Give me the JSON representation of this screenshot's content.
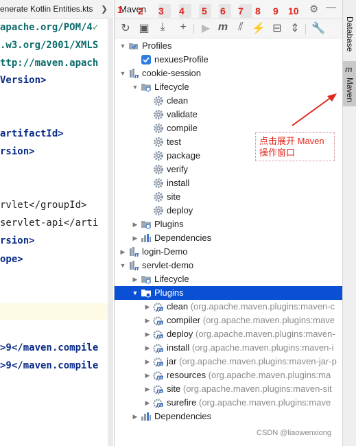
{
  "editor": {
    "tab_title": "enerate Kotlin Entities.kts",
    "tab_chevron": "❯",
    "code_lines": [
      {
        "text": "apache.org/POM/4",
        "extra": "✓"
      },
      {
        "text": ".w3.org/2001/XMLS",
        "extra": ""
      },
      {
        "text": "ttp://maven.apach",
        "extra": ""
      },
      {
        "text": "Version>",
        "extra": ""
      },
      {
        "text": "artifactId>",
        "extra": ""
      },
      {
        "text": "rsion>",
        "extra": ""
      },
      {
        "text": "rvlet</groupId>",
        "extra": ""
      },
      {
        "text": "servlet-api</arti",
        "extra": ""
      },
      {
        "text": "rsion>",
        "extra": ""
      },
      {
        "text": "ope>",
        "extra": ""
      },
      {
        "text": ">9</maven.compile",
        "extra": ""
      },
      {
        "text": ">9</maven.compile",
        "extra": ""
      }
    ]
  },
  "panel": {
    "title": "Maven",
    "numbers": [
      "1",
      "2",
      "3",
      "4",
      "5",
      "6",
      "7",
      "8",
      "9",
      "10"
    ]
  },
  "tree": [
    {
      "label": "Profiles",
      "detail": "",
      "icon": "profiles-icon"
    },
    {
      "label": "nexuesProfile",
      "detail": "",
      "icon": "checkbox-checked-icon"
    },
    {
      "label": "cookie-session",
      "detail": "",
      "icon": "maven-module-icon"
    },
    {
      "label": "Lifecycle",
      "detail": "",
      "icon": "lifecycle-folder-icon"
    },
    {
      "label": "clean",
      "detail": "",
      "icon": "gear-icon"
    },
    {
      "label": "validate",
      "detail": "",
      "icon": "gear-icon"
    },
    {
      "label": "compile",
      "detail": "",
      "icon": "gear-icon"
    },
    {
      "label": "test",
      "detail": "",
      "icon": "gear-icon"
    },
    {
      "label": "package",
      "detail": "",
      "icon": "gear-icon"
    },
    {
      "label": "verify",
      "detail": "",
      "icon": "gear-icon"
    },
    {
      "label": "install",
      "detail": "",
      "icon": "gear-icon"
    },
    {
      "label": "site",
      "detail": "",
      "icon": "gear-icon"
    },
    {
      "label": "deploy",
      "detail": "",
      "icon": "gear-icon"
    },
    {
      "label": "Plugins",
      "detail": "",
      "icon": "plugins-folder-icon"
    },
    {
      "label": "Dependencies",
      "detail": "",
      "icon": "dependencies-icon"
    },
    {
      "label": "login-Demo",
      "detail": "",
      "icon": "maven-module-icon"
    },
    {
      "label": "servlet-demo",
      "detail": "",
      "icon": "maven-module-icon"
    },
    {
      "label": "Lifecycle",
      "detail": "",
      "icon": "lifecycle-folder-icon"
    },
    {
      "label": "Plugins",
      "detail": "",
      "icon": "plugins-folder-icon"
    },
    {
      "label": "clean",
      "detail": "(org.apache.maven.plugins:maven-c",
      "icon": "plugin-goal-icon"
    },
    {
      "label": "compiler",
      "detail": "(org.apache.maven.plugins:mave",
      "icon": "plugin-goal-icon"
    },
    {
      "label": "deploy",
      "detail": "(org.apache.maven.plugins:maven-",
      "icon": "plugin-goal-icon"
    },
    {
      "label": "install",
      "detail": "(org.apache.maven.plugins:maven-i",
      "icon": "plugin-goal-icon"
    },
    {
      "label": "jar",
      "detail": "(org.apache.maven.plugins:maven-jar-p",
      "icon": "plugin-goal-icon"
    },
    {
      "label": "resources",
      "detail": "(org.apache.maven.plugins:ma",
      "icon": "plugin-goal-icon"
    },
    {
      "label": "site",
      "detail": "(org.apache.maven.plugins:maven-sit",
      "icon": "plugin-goal-icon"
    },
    {
      "label": "surefire",
      "detail": "(org.apache.maven.plugins:mave",
      "icon": "plugin-goal-icon"
    },
    {
      "label": "Dependencies",
      "detail": "",
      "icon": "dependencies-icon"
    }
  ],
  "sidebar": {
    "database_label": "Database",
    "maven_label": "Maven"
  },
  "annotation": {
    "line1": "点击展开 Maven",
    "line2": "操作窗口"
  },
  "watermark": "CSDN @liaowenxiong",
  "colors": {
    "selection": "#0a50d4",
    "annotation_red": "#e0251b",
    "code_teal": "#0b6b6b",
    "code_navy": "#0a2b87"
  }
}
